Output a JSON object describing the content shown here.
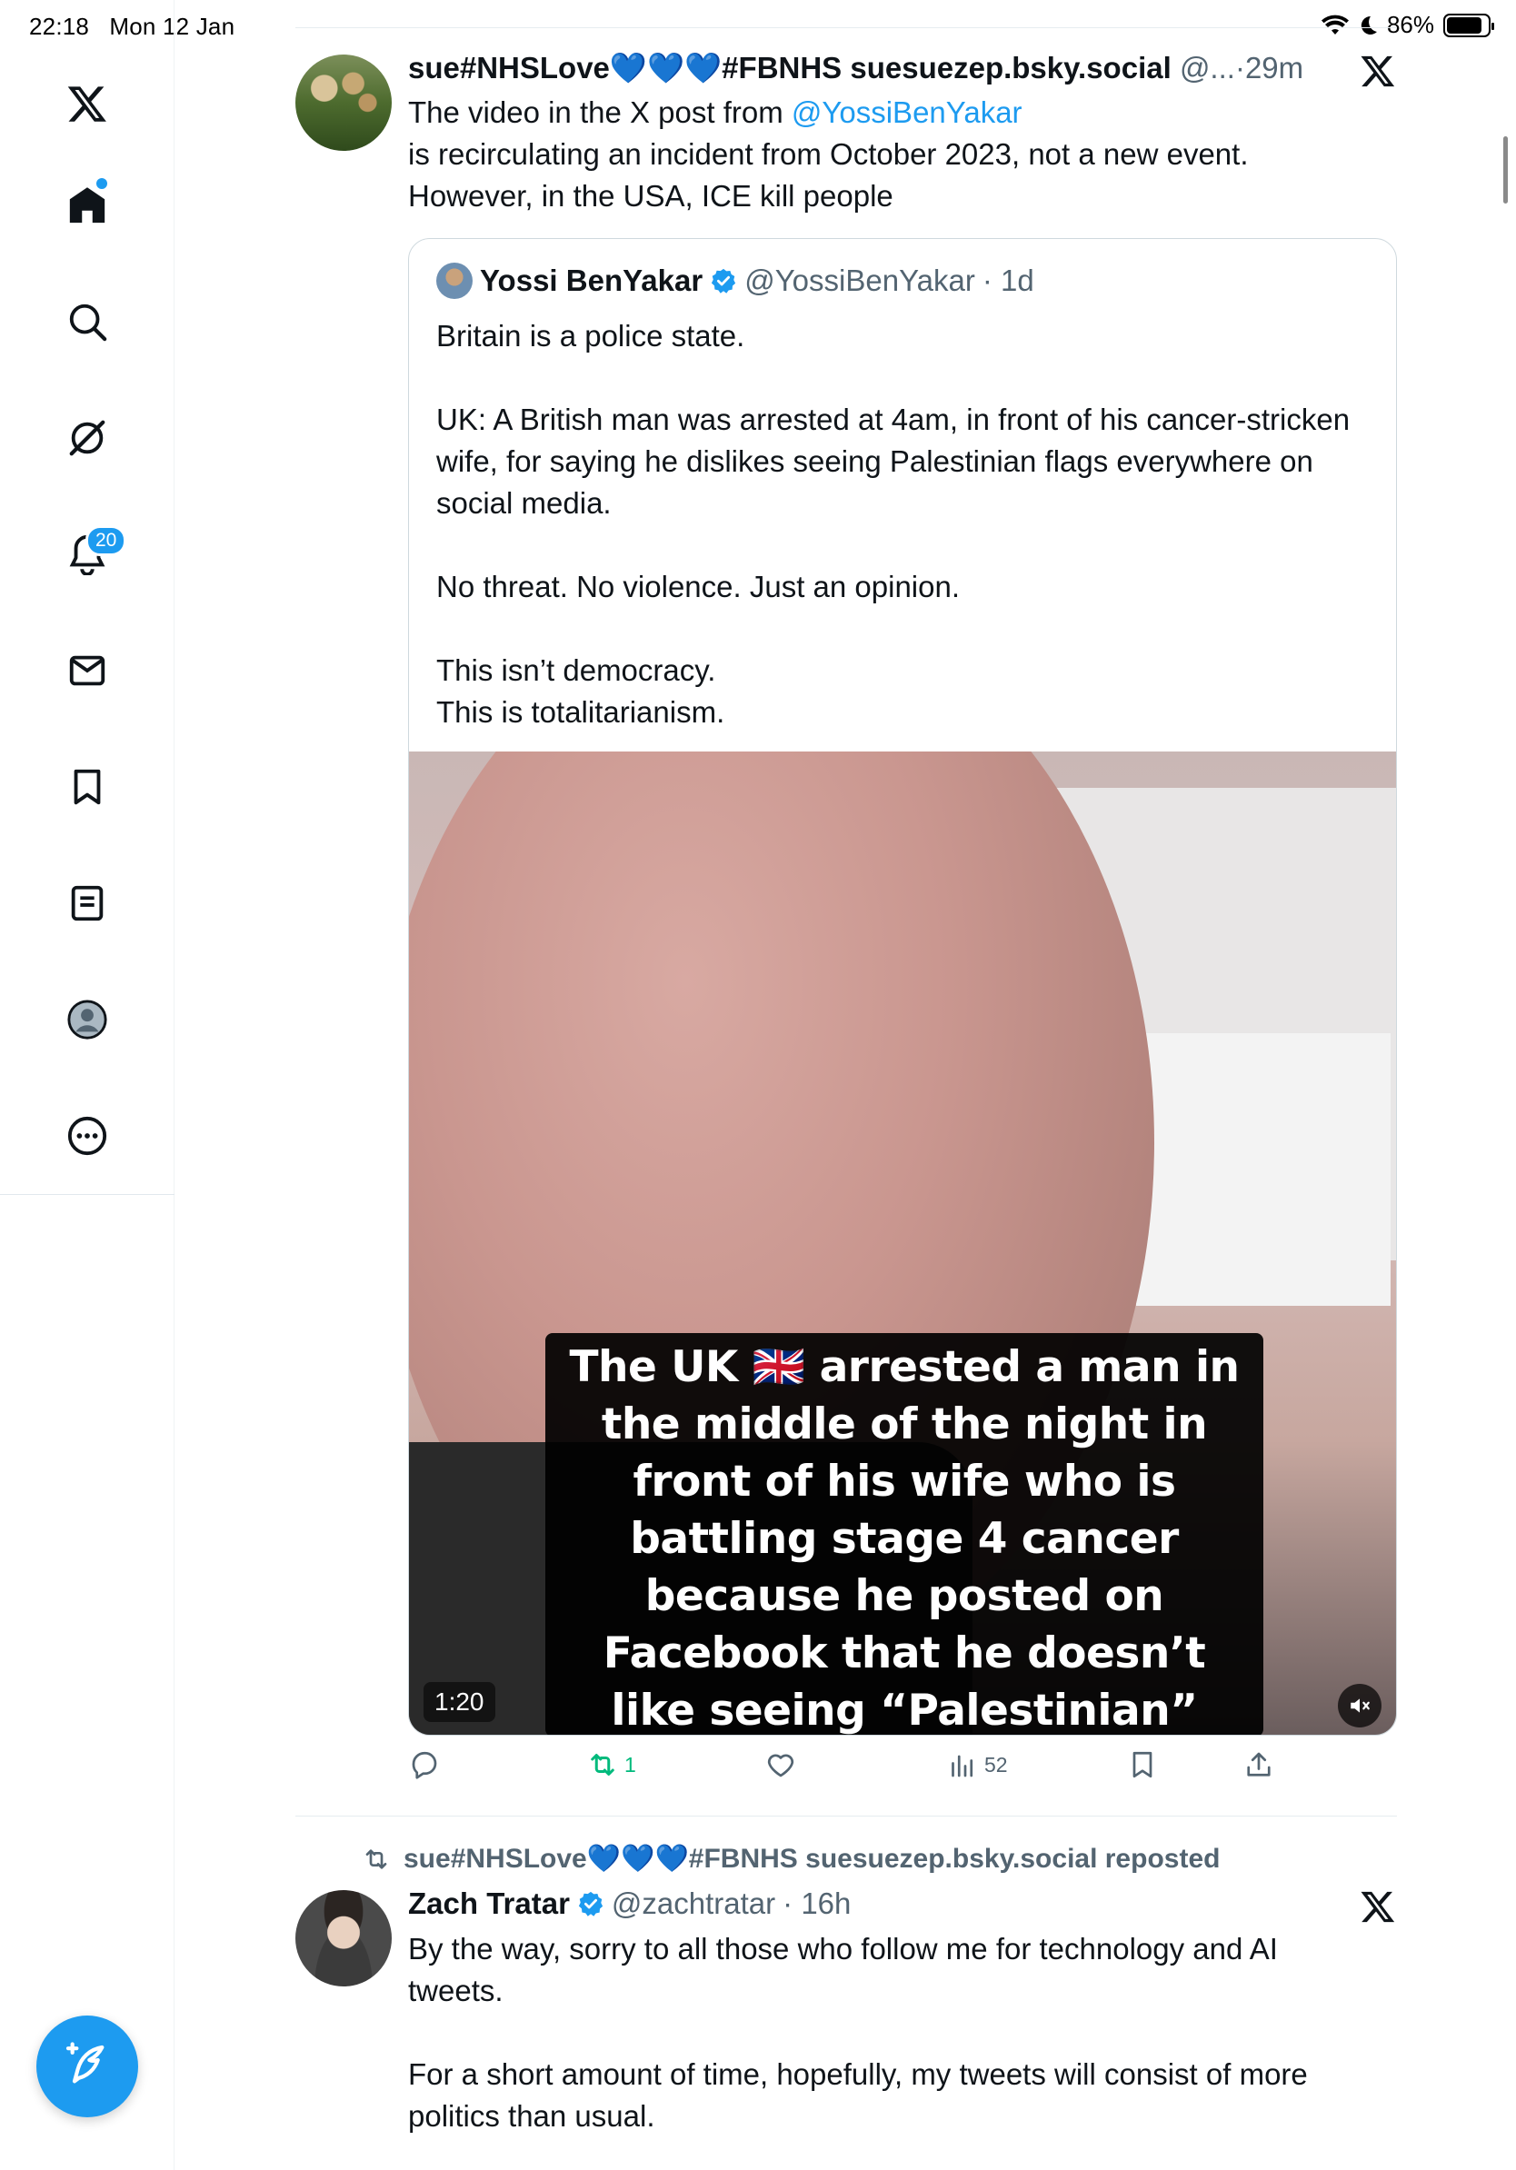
{
  "status_bar": {
    "time": "22:18",
    "date": "Mon 12 Jan",
    "battery": "86%",
    "battery_level": 0.86
  },
  "sidebar": {
    "items": [
      {
        "name": "x-logo-icon"
      },
      {
        "name": "home-icon"
      },
      {
        "name": "search-icon"
      },
      {
        "name": "grok-icon"
      },
      {
        "name": "notifications-icon",
        "badge": "20"
      },
      {
        "name": "messages-icon"
      },
      {
        "name": "bookmarks-icon"
      },
      {
        "name": "lists-icon"
      },
      {
        "name": "profile-icon"
      },
      {
        "name": "more-icon"
      }
    ],
    "compose_icon": "compose-post-icon"
  },
  "post1": {
    "display_name": "sue#NHSLove💙💙💙#FBNHS suesuezep.bsky.social",
    "handle": "@...",
    "separator": "·",
    "time": "29m",
    "text_prefix": "The video in the X post from ",
    "mention": "@YossiBenYakar",
    "text_line2": "is  recirculating an incident from October 2023, not a new event.",
    "text_line3": "However, in the USA, ICE kill people",
    "quote": {
      "display_name": "Yossi BenYakar",
      "handle": "@YossiBenYakar",
      "time": "· 1d",
      "paragraphs": [
        "Britain is a police state.",
        "UK: A British man was arrested at 4am, in front of his cancer-stricken wife, for saying he dislikes seeing Palestinian flags everywhere on social media.",
        "No threat. No violence. Just an opinion.",
        "This isn’t democracy.\nThis is totalitarianism."
      ],
      "video": {
        "caption": "The UK 🇬🇧 arrested a man in the middle of the night in front of his wife who is battling stage 4 cancer because he posted on Facebook that he doesn’t like seeing “Palestinian” flags.",
        "duration": "1:20"
      }
    },
    "actions": {
      "reply": "",
      "repost": "1",
      "like": "",
      "views": "52",
      "bookmark": "",
      "share": ""
    },
    "colors": {
      "repost_active": "#00ba7c",
      "link": "#1d9bf0"
    }
  },
  "post2": {
    "repost_label": "sue#NHSLove💙💙💙#FBNHS suesuezep.bsky.social reposted",
    "display_name": "Zach Tratar",
    "handle": "@zachtratar",
    "time": "· 16h",
    "paragraphs": [
      "By the way, sorry to all those who follow me for technology and AI tweets.",
      "For a short amount of time, hopefully, my tweets will consist of more politics than usual."
    ]
  }
}
